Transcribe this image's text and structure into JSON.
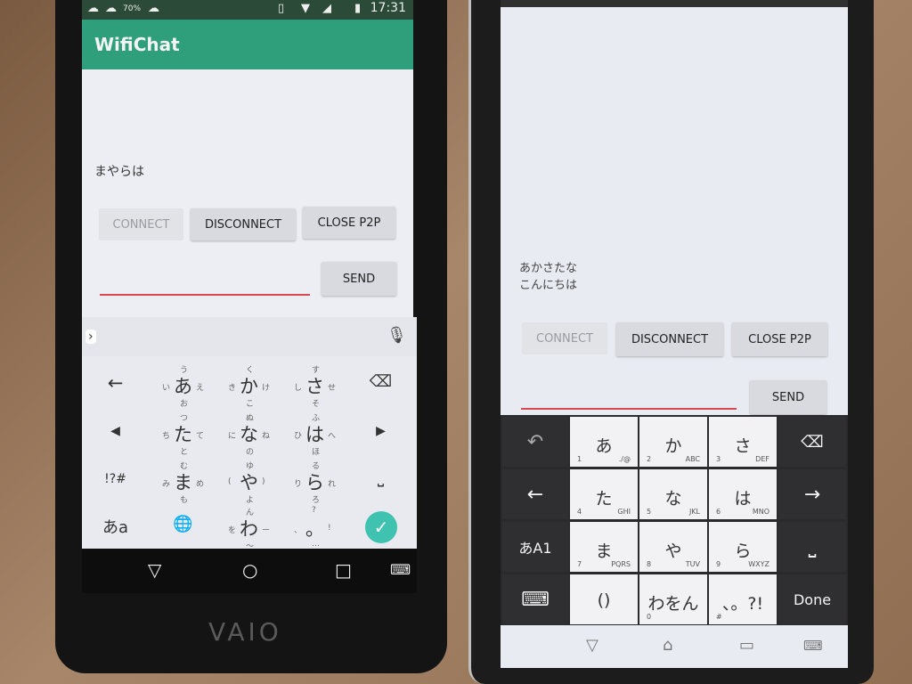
{
  "left_phone": {
    "status": {
      "time": "17:31",
      "battery_pct": "70%"
    },
    "app_title": "WifiChat",
    "message": "まやらは",
    "buttons": {
      "connect": "CONNECT",
      "disconnect": "DISCONNECT",
      "close_p2p": "CLOSE P2P",
      "send": "SEND"
    },
    "input_value": "",
    "keyboard": {
      "left_keys": [
        "←",
        "◀",
        "!?#",
        "あa"
      ],
      "right_keys": [
        "⌫",
        "▶",
        "⎵",
        "✓"
      ],
      "keys": [
        {
          "main": "あ",
          "left": "い",
          "top": "う",
          "right": "え",
          "bottom": "お"
        },
        {
          "main": "か",
          "left": "き",
          "top": "く",
          "right": "け",
          "bottom": "こ"
        },
        {
          "main": "さ",
          "left": "し",
          "top": "す",
          "right": "せ",
          "bottom": "そ"
        },
        {
          "main": "た",
          "left": "ち",
          "top": "つ",
          "right": "て",
          "bottom": "と"
        },
        {
          "main": "な",
          "left": "に",
          "top": "ぬ",
          "right": "ね",
          "bottom": "の"
        },
        {
          "main": "は",
          "left": "ひ",
          "top": "ふ",
          "right": "へ",
          "bottom": "ほ"
        },
        {
          "main": "ま",
          "left": "み",
          "top": "む",
          "right": "め",
          "bottom": "も"
        },
        {
          "main": "や",
          "left": "(",
          "top": "ゆ",
          "right": ")",
          "bottom": "よ"
        },
        {
          "main": "ら",
          "left": "り",
          "top": "る",
          "right": "れ",
          "bottom": "ろ"
        },
        {
          "main": "🌐",
          "left": "",
          "top": "",
          "right": "",
          "bottom": ""
        },
        {
          "main": "わ",
          "left": "を",
          "top": "ん",
          "right": "ー",
          "bottom": "〜"
        },
        {
          "main": "。",
          "left": "、",
          "top": "?",
          "right": "!",
          "bottom": "…"
        }
      ]
    },
    "brand": "VAIO"
  },
  "right_phone": {
    "messages": [
      "あかさたな",
      "こんにちは"
    ],
    "buttons": {
      "connect": "CONNECT",
      "disconnect": "DISCONNECT",
      "close_p2p": "CLOSE P2P",
      "send": "SEND"
    },
    "input_value": "",
    "keyboard": {
      "left_keys": [
        "↶",
        "←",
        "あA1",
        "⌨"
      ],
      "right_keys": [
        "⌫",
        "→",
        "⎵",
        "Done"
      ],
      "keys": [
        {
          "main": "あ",
          "sub_l": "1",
          "sub_r": "./@"
        },
        {
          "main": "か",
          "sub_l": "2",
          "sub_r": "ABC"
        },
        {
          "main": "さ",
          "sub_l": "3",
          "sub_r": "DEF"
        },
        {
          "main": "た",
          "sub_l": "4",
          "sub_r": "GHI"
        },
        {
          "main": "な",
          "sub_l": "5",
          "sub_r": "JKL"
        },
        {
          "main": "は",
          "sub_l": "6",
          "sub_r": "MNO"
        },
        {
          "main": "ま",
          "sub_l": "7",
          "sub_r": "PQRS"
        },
        {
          "main": "や",
          "sub_l": "8",
          "sub_r": "TUV"
        },
        {
          "main": "ら",
          "sub_l": "9",
          "sub_r": "WXYZ"
        },
        {
          "main": "()",
          "sub_l": "",
          "sub_r": ""
        },
        {
          "main": "わをん",
          "sub_l": "0",
          "sub_r": ""
        },
        {
          "main": "、。?!",
          "sub_l": "#",
          "sub_r": ""
        }
      ]
    }
  },
  "colors": {
    "appbar": "#2e9f7a",
    "accent_underline": "#d9474f",
    "check": "#3fc3b0"
  }
}
